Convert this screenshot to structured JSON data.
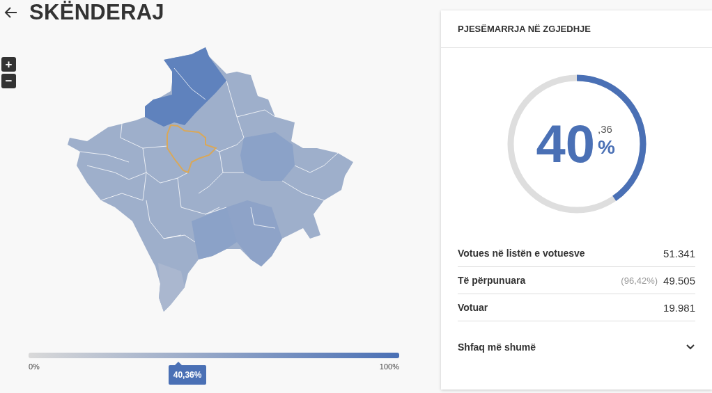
{
  "header": {
    "title": "SKËNDERAJ"
  },
  "zoom": {
    "in_label": "+",
    "out_label": "−"
  },
  "legend": {
    "min_label": "0%",
    "max_label": "100%",
    "marker": {
      "label": "40,36%",
      "level": 0.4036
    }
  },
  "panel": {
    "title": "PJESËMARRJA NË ZGJEDHJE",
    "gauge": {
      "integer": "40",
      "decimal": ",36",
      "unit": "%",
      "level": 0.4036
    },
    "rows": [
      {
        "label": "Votues në listën e votuesve",
        "value": "51.341"
      },
      {
        "label": "Të përpunuara",
        "note": "(96,42%)",
        "value": "49.505"
      },
      {
        "label": "Votuar",
        "value": "19.981"
      }
    ],
    "more_label": "Shfaq më shumë"
  }
}
